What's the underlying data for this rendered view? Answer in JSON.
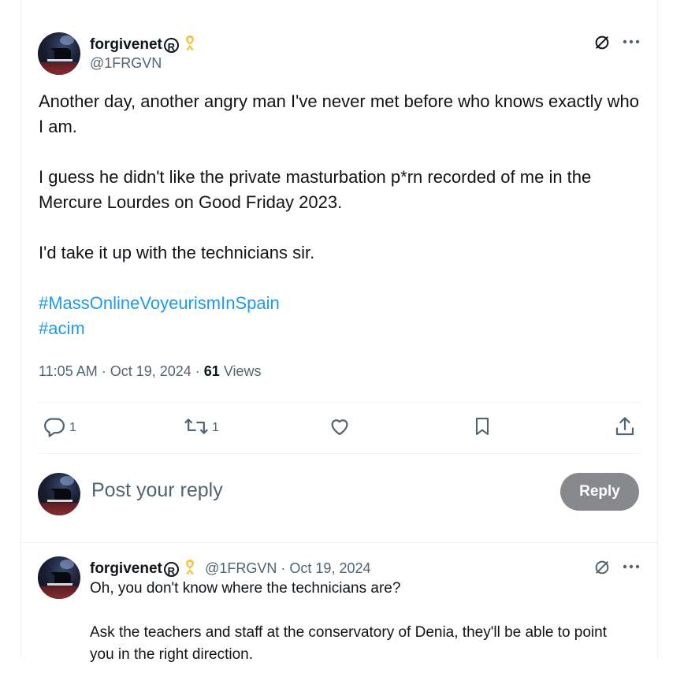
{
  "main_tweet": {
    "author_name": "forgivenet",
    "registered_mark": "R",
    "handle": "@1FRGVN",
    "text_paragraphs": [
      "Another day, another angry man I've never met before who knows exactly who I am.",
      "I guess he didn't like the private masturbation p*rn recorded of me in the Mercure Lourdes on Good Friday 2023.",
      "I'd take it up with the technicians sir."
    ],
    "hashtags": [
      "#MassOnlineVoyeurismInSpain",
      "#acim"
    ],
    "time": "11:05 AM",
    "date": "Oct 19, 2024",
    "views_count": "61",
    "views_label": "Views",
    "actions": {
      "reply_count": "1",
      "retweet_count": "1",
      "like_count": "",
      "bookmark_count": "",
      "share_count": ""
    },
    "icons": [
      "grok-icon",
      "more-icon",
      "reply-icon",
      "retweet-icon",
      "like-icon",
      "bookmark-icon",
      "share-icon",
      "ribbon-icon"
    ]
  },
  "reply_composer": {
    "placeholder": "Post your reply",
    "button_label": "Reply"
  },
  "reply_tweet": {
    "author_name": "forgivenet",
    "registered_mark": "R",
    "handle_date": "@1FRGVN · Oct 19, 2024",
    "text_paragraphs": [
      "Oh, you don't know where the technicians are?",
      "Ask the teachers and staff at the conservatory of Denia, they'll be able to point you in the right direction."
    ]
  },
  "colors": {
    "text": "#0f1419",
    "secondary": "#536471",
    "link": "#1d9bf0",
    "ribbon": "#f4c542",
    "reply_button_bg": "#87898c",
    "divider": "#eff3f4"
  }
}
